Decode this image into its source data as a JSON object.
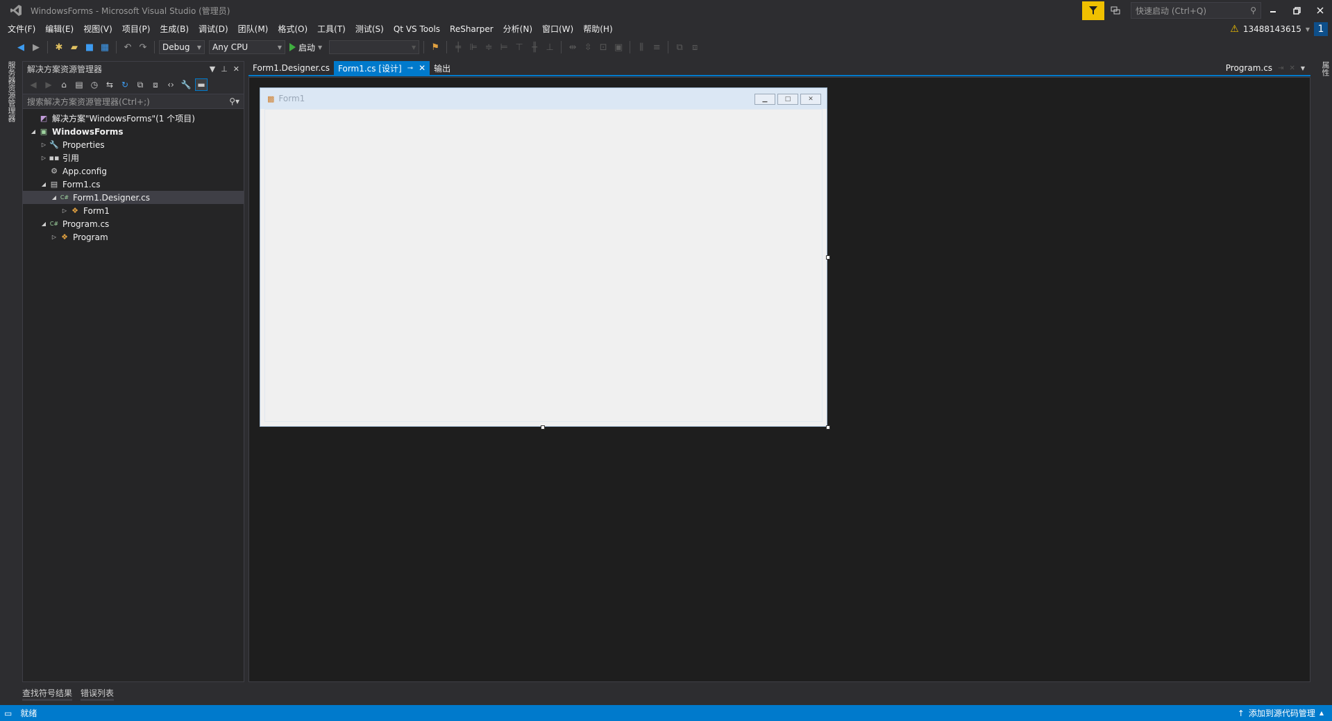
{
  "window": {
    "title": "WindowsForms - Microsoft Visual Studio (管理员)",
    "quick_launch_placeholder": "快速启动 (Ctrl+Q)"
  },
  "menu": {
    "items": [
      "文件(F)",
      "编辑(E)",
      "视图(V)",
      "项目(P)",
      "生成(B)",
      "调试(D)",
      "团队(M)",
      "格式(O)",
      "工具(T)",
      "测试(S)",
      "Qt VS Tools",
      "ReSharper",
      "分析(N)",
      "窗口(W)",
      "帮助(H)"
    ],
    "user": "13488143615",
    "notifications": "1"
  },
  "toolbar": {
    "config": "Debug",
    "platform": "Any CPU",
    "start_label": "启动"
  },
  "left_strip": {
    "label": "服务器资源管理器"
  },
  "right_strip": {
    "label": "属性"
  },
  "solution_explorer": {
    "title": "解决方案资源管理器",
    "search_placeholder": "搜索解决方案资源管理器(Ctrl+;)",
    "tree": [
      {
        "label": "解决方案\"WindowsForms\"(1 个项目)",
        "depth": 0,
        "arrow": "",
        "icon": "solution-icon",
        "bold": false
      },
      {
        "label": "WindowsForms",
        "depth": 0,
        "arrow": "◢",
        "icon": "csharp-project-icon",
        "bold": true
      },
      {
        "label": "Properties",
        "depth": 1,
        "arrow": "▷",
        "icon": "wrench-icon",
        "bold": false
      },
      {
        "label": "引用",
        "depth": 1,
        "arrow": "▷",
        "icon": "references-icon",
        "bold": false
      },
      {
        "label": "App.config",
        "depth": 1,
        "arrow": "",
        "icon": "config-file-icon",
        "bold": false
      },
      {
        "label": "Form1.cs",
        "depth": 1,
        "arrow": "◢",
        "icon": "form-icon",
        "bold": false
      },
      {
        "label": "Form1.Designer.cs",
        "depth": 2,
        "arrow": "◢",
        "icon": "cs-file-icon",
        "bold": false,
        "selected": true
      },
      {
        "label": "Form1",
        "depth": 3,
        "arrow": "▷",
        "icon": "class-icon",
        "bold": false
      },
      {
        "label": "Program.cs",
        "depth": 1,
        "arrow": "◢",
        "icon": "cs-file-icon",
        "bold": false
      },
      {
        "label": "Program",
        "depth": 2,
        "arrow": "▷",
        "icon": "class-icon",
        "bold": false
      }
    ]
  },
  "bottom_tabs": [
    "查找符号结果",
    "错误列表"
  ],
  "doc_tabs": {
    "tabs": [
      {
        "label": "Form1.Designer.cs",
        "active": false
      },
      {
        "label": "Form1.cs [设计]",
        "active": true
      },
      {
        "label": "输出",
        "active": false
      }
    ],
    "right_tab": "Program.cs"
  },
  "designer": {
    "form_title": "Form1"
  },
  "status": {
    "left": "就绪",
    "right": "添加到源代码管理"
  },
  "colors": {
    "accent": "#007acc",
    "background": "#2d2d30",
    "editor": "#1e1e1e",
    "filter": "#f0c000"
  }
}
